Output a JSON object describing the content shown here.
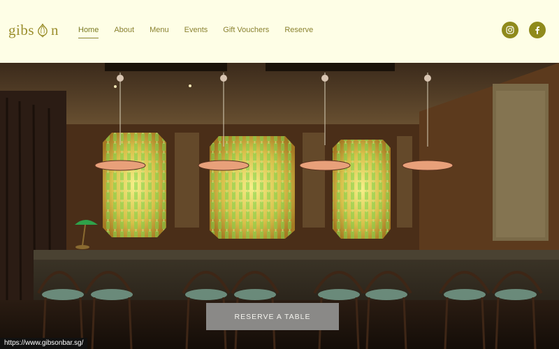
{
  "brand": {
    "name_left": "gibs",
    "name_right": "n",
    "logo_icon": "onion-icon"
  },
  "nav": {
    "items": [
      {
        "label": "Home",
        "active": true
      },
      {
        "label": "About"
      },
      {
        "label": "Menu"
      },
      {
        "label": "Events"
      },
      {
        "label": "Gift Vouchers"
      },
      {
        "label": "Reserve"
      }
    ]
  },
  "social": [
    {
      "icon": "instagram-icon"
    },
    {
      "icon": "facebook-icon"
    }
  ],
  "hero": {
    "cta_label": "RESERVE A TABLE"
  },
  "footer_url": "https://www.gibsonbar.sg/",
  "colors": {
    "background": "#fefee6",
    "accent": "#8f8a1c",
    "nav_text": "#8a8230",
    "cta_bg": "#8a8987"
  }
}
